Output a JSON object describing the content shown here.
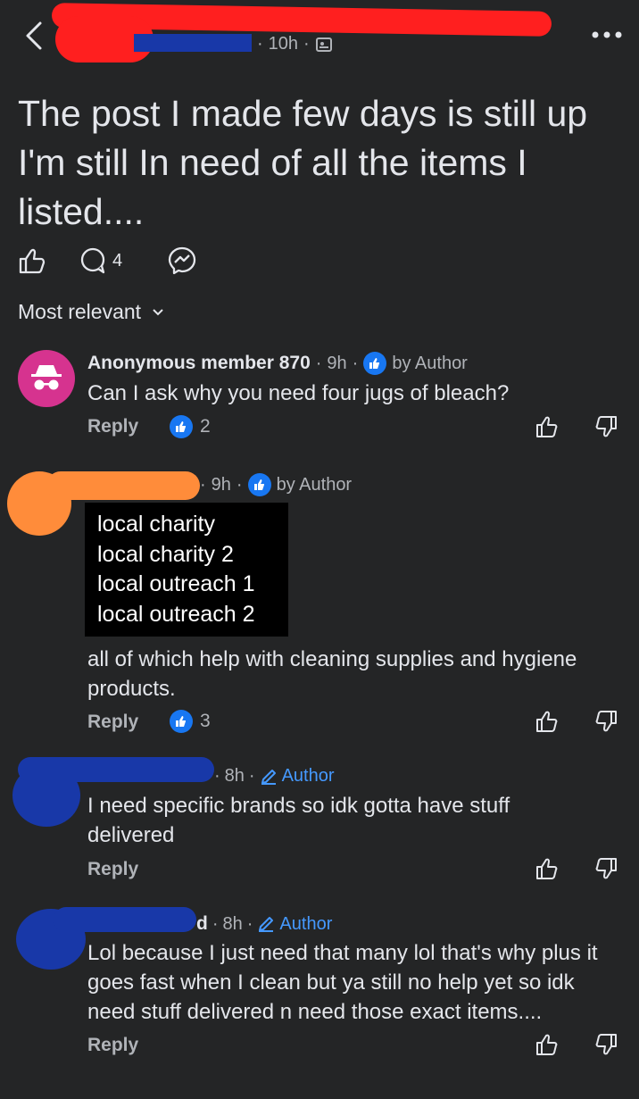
{
  "header": {
    "time": "10h"
  },
  "post": {
    "title": "The post I made few days is still up I'm still In need of all the items I listed....",
    "comment_count": "4"
  },
  "sort": {
    "label": "Most relevant"
  },
  "comments": [
    {
      "author": "Anonymous member 870",
      "time": "9h",
      "liked_by": "by Author",
      "text": "Can I ask why you need four jugs of bleach?",
      "reply_label": "Reply",
      "reactions": "2"
    },
    {
      "time": "9h",
      "liked_by": "by Author",
      "list": [
        "local charity",
        "local charity 2",
        "local outreach 1",
        "local outreach 2"
      ],
      "text": "all of which help with cleaning supplies and hygiene products.",
      "reply_label": "Reply",
      "reactions": "3"
    },
    {
      "time": "8h",
      "author_badge": "Author",
      "text": "I need specific brands so idk gotta have stuff delivered",
      "reply_label": "Reply"
    },
    {
      "time": "8h",
      "author_badge": "Author",
      "text": "Lol because I just need that many lol that's why plus it goes fast when I clean but ya still no help yet so idk need stuff delivered n need those exact items....",
      "reply_label": "Reply"
    }
  ],
  "colors": {
    "background": "#242526",
    "text": "#e4e6eb",
    "muted": "#b0b3b8",
    "accent": "#1877f2",
    "anon_avatar": "#d6338f"
  }
}
